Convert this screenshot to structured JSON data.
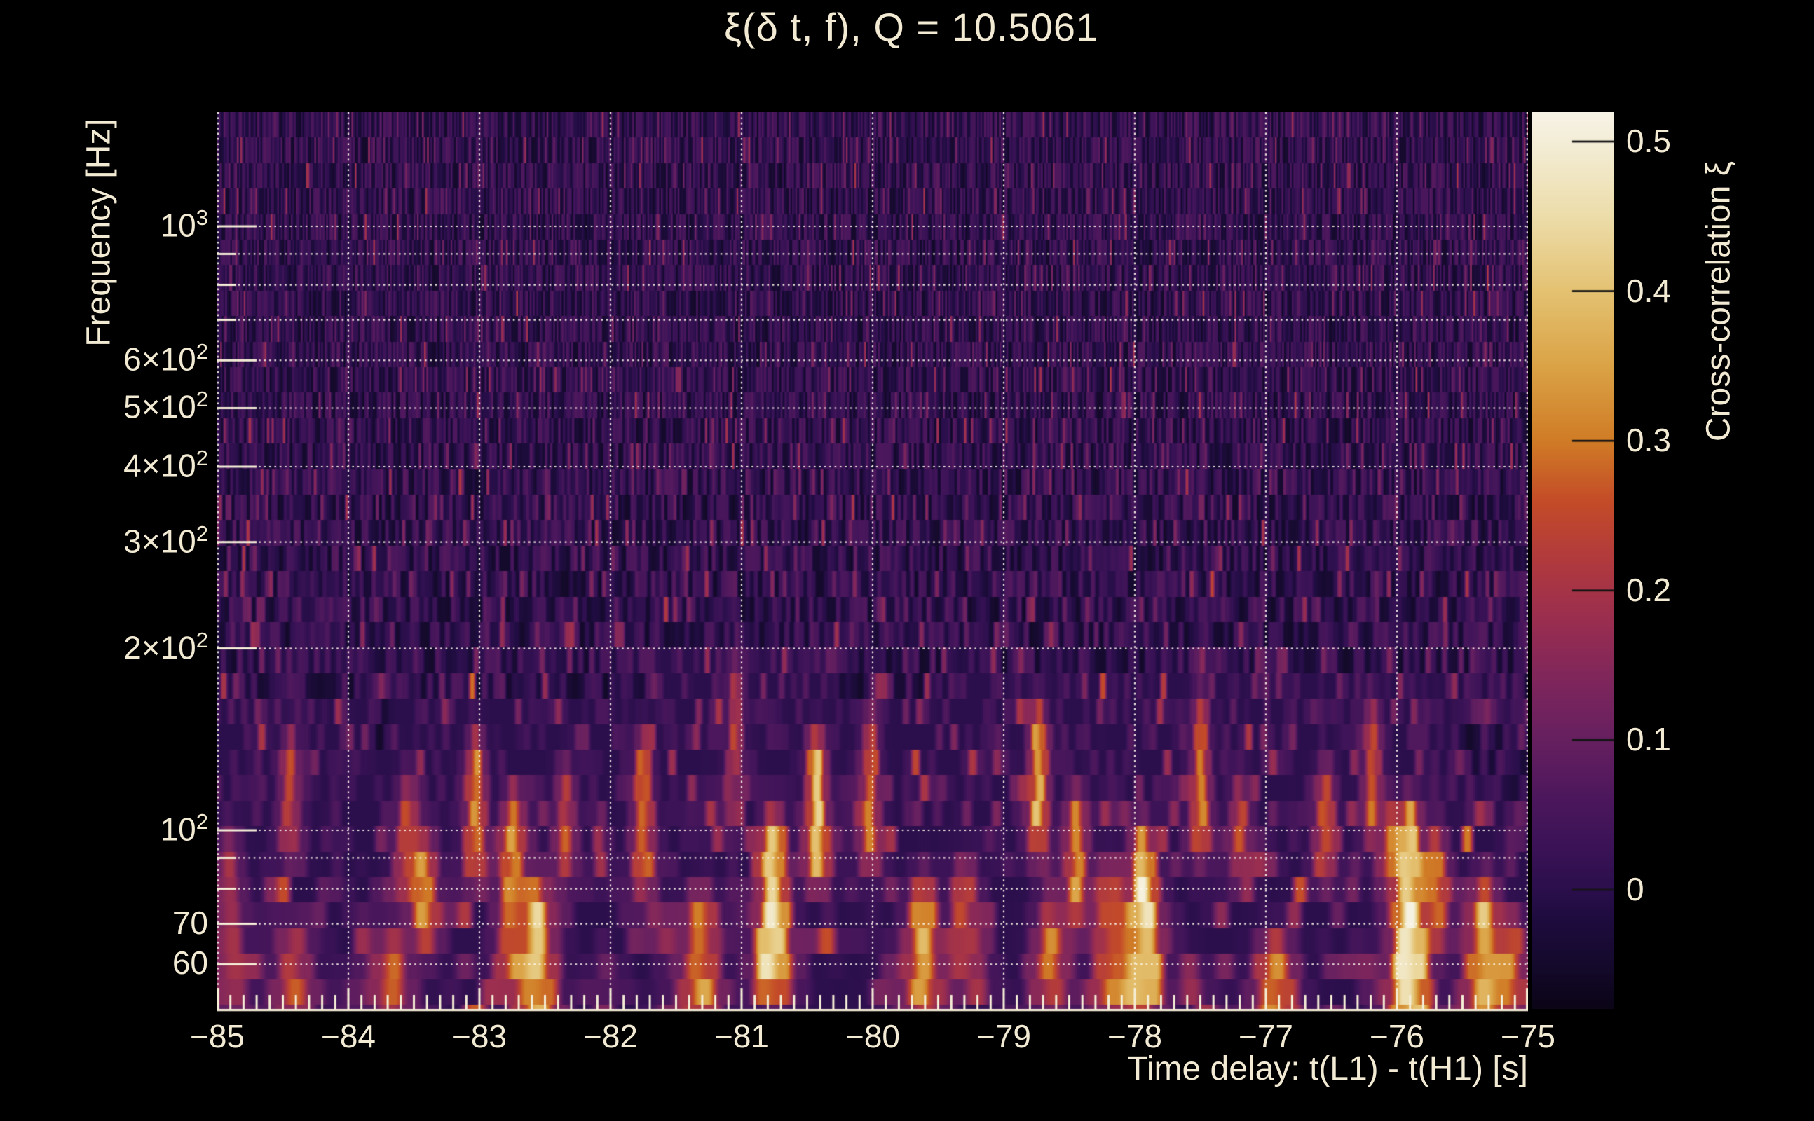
{
  "chart_data": {
    "type": "heatmap",
    "title": "ξ(δ t, f), Q = 10.5061",
    "q_value": 10.5061,
    "xlabel": "Time delay: t(L1) - t(H1) [s]",
    "ylabel": "Frequency [Hz]",
    "colorbar_label": "Cross-correlation ξ",
    "x_range": [
      -85,
      -75
    ],
    "x_minor_tick_step": 0.1,
    "y_scale": "log",
    "y_range_hz": [
      50.6,
      1546
    ],
    "color_range": [
      -0.08,
      0.52
    ],
    "grid": true,
    "x_ticks": [
      {
        "v": -85,
        "label": "−85"
      },
      {
        "v": -84,
        "label": "−84"
      },
      {
        "v": -83,
        "label": "−83"
      },
      {
        "v": -82,
        "label": "−82"
      },
      {
        "v": -81,
        "label": "−81"
      },
      {
        "v": -80,
        "label": "−80"
      },
      {
        "v": -79,
        "label": "−79"
      },
      {
        "v": -78,
        "label": "−78"
      },
      {
        "v": -77,
        "label": "−77"
      },
      {
        "v": -76,
        "label": "−76"
      },
      {
        "v": -75,
        "label": "−75"
      }
    ],
    "y_ticks_labeled": [
      {
        "f": 1000,
        "base": "10",
        "exp": "3"
      },
      {
        "f": 600,
        "base": "6×10",
        "exp": "2"
      },
      {
        "f": 500,
        "base": "5×10",
        "exp": "2"
      },
      {
        "f": 400,
        "base": "4×10",
        "exp": "2"
      },
      {
        "f": 300,
        "base": "3×10",
        "exp": "2"
      },
      {
        "f": 200,
        "base": "2×10",
        "exp": "2"
      },
      {
        "f": 100,
        "base": "10",
        "exp": "2"
      },
      {
        "f": 70,
        "base": "70",
        "exp": ""
      },
      {
        "f": 60,
        "base": "60",
        "exp": ""
      }
    ],
    "y_ticks_minor": [
      900,
      800,
      700,
      90,
      80
    ],
    "y_gridlines": [
      60,
      70,
      80,
      90,
      100,
      200,
      300,
      400,
      500,
      600,
      700,
      800,
      900,
      1000
    ],
    "colorbar_ticks": [
      {
        "v": 0.5,
        "label": "0.5"
      },
      {
        "v": 0.4,
        "label": "0.4"
      },
      {
        "v": 0.3,
        "label": "0.3"
      },
      {
        "v": 0.2,
        "label": "0.2"
      },
      {
        "v": 0.1,
        "label": "0.1"
      },
      {
        "v": 0.0,
        "label": "0"
      }
    ],
    "colormap": [
      {
        "v": -0.08,
        "c": "#0b0517"
      },
      {
        "v": -0.05,
        "c": "#150a2c"
      },
      {
        "v": -0.02,
        "c": "#1e0c3e"
      },
      {
        "v": 0.0,
        "c": "#2b0f4c"
      },
      {
        "v": 0.03,
        "c": "#3c1357"
      },
      {
        "v": 0.06,
        "c": "#4c175c"
      },
      {
        "v": 0.1,
        "c": "#662060"
      },
      {
        "v": 0.14,
        "c": "#7f265c"
      },
      {
        "v": 0.18,
        "c": "#9a2e50"
      },
      {
        "v": 0.22,
        "c": "#b13a3e"
      },
      {
        "v": 0.26,
        "c": "#c44c28"
      },
      {
        "v": 0.3,
        "c": "#d07c26"
      },
      {
        "v": 0.35,
        "c": "#dba346"
      },
      {
        "v": 0.4,
        "c": "#e4c272"
      },
      {
        "v": 0.45,
        "c": "#edddaa"
      },
      {
        "v": 0.5,
        "c": "#f4eed8"
      },
      {
        "v": 0.52,
        "c": "#f7f3e6"
      }
    ],
    "hotspots": [
      {
        "t": -84.92,
        "f1": 55,
        "f2": 90,
        "xi": 0.22
      },
      {
        "t": -84.45,
        "f1": 100,
        "f2": 130,
        "xi": 0.25
      },
      {
        "t": -84.42,
        "f1": 52,
        "f2": 62,
        "xi": 0.25
      },
      {
        "t": -83.67,
        "f1": 52,
        "f2": 62,
        "xi": 0.28
      },
      {
        "t": -83.55,
        "f1": 85,
        "f2": 110,
        "xi": 0.28
      },
      {
        "t": -83.43,
        "f1": 70,
        "f2": 90,
        "xi": 0.33
      },
      {
        "t": -83.03,
        "f1": 90,
        "f2": 130,
        "xi": 0.34
      },
      {
        "t": -82.74,
        "f1": 60,
        "f2": 105,
        "xi": 0.35
      },
      {
        "t": -82.57,
        "f1": 50,
        "f2": 75,
        "xi": 0.4
      },
      {
        "t": -82.35,
        "f1": 90,
        "f2": 115,
        "xi": 0.25
      },
      {
        "t": -81.75,
        "f1": 85,
        "f2": 130,
        "xi": 0.3
      },
      {
        "t": -81.32,
        "f1": 52,
        "f2": 72,
        "xi": 0.35
      },
      {
        "t": -81.05,
        "f1": 130,
        "f2": 170,
        "xi": 0.24
      },
      {
        "t": -80.76,
        "f1": 58,
        "f2": 95,
        "xi": 0.5
      },
      {
        "t": -80.43,
        "f1": 90,
        "f2": 130,
        "xi": 0.42
      },
      {
        "t": -80.02,
        "f1": 95,
        "f2": 140,
        "xi": 0.3
      },
      {
        "t": -79.62,
        "f1": 52,
        "f2": 75,
        "xi": 0.35
      },
      {
        "t": -79.3,
        "f1": 60,
        "f2": 80,
        "xi": 0.25
      },
      {
        "t": -78.74,
        "f1": 100,
        "f2": 145,
        "xi": 0.4
      },
      {
        "t": -78.64,
        "f1": 55,
        "f2": 70,
        "xi": 0.3
      },
      {
        "t": -78.45,
        "f1": 75,
        "f2": 105,
        "xi": 0.32
      },
      {
        "t": -78.18,
        "f1": 52,
        "f2": 80,
        "xi": 0.3
      },
      {
        "t": -77.94,
        "f1": 55,
        "f2": 90,
        "xi": 0.48
      },
      {
        "t": -77.5,
        "f1": 100,
        "f2": 150,
        "xi": 0.32
      },
      {
        "t": -77.2,
        "f1": 90,
        "f2": 110,
        "xi": 0.25
      },
      {
        "t": -76.93,
        "f1": 50,
        "f2": 60,
        "xi": 0.35
      },
      {
        "t": -76.55,
        "f1": 90,
        "f2": 115,
        "xi": 0.28
      },
      {
        "t": -76.19,
        "f1": 105,
        "f2": 145,
        "xi": 0.3
      },
      {
        "t": -76.05,
        "f1": 85,
        "f2": 100,
        "xi": 0.3
      },
      {
        "t": -75.91,
        "f1": 50,
        "f2": 100,
        "xi": 0.52
      },
      {
        "t": -75.72,
        "f1": 70,
        "f2": 90,
        "xi": 0.35
      },
      {
        "t": -75.34,
        "f1": 50,
        "f2": 75,
        "xi": 0.38
      },
      {
        "t": -75.15,
        "f1": 52,
        "f2": 65,
        "xi": 0.3
      }
    ],
    "style": {
      "text_color": "#f2ead3",
      "background": "#000000",
      "gridline_color": "#fdf8ee",
      "tick_color": "#f5eed7",
      "colorbar_tick_color": "#141414"
    }
  }
}
